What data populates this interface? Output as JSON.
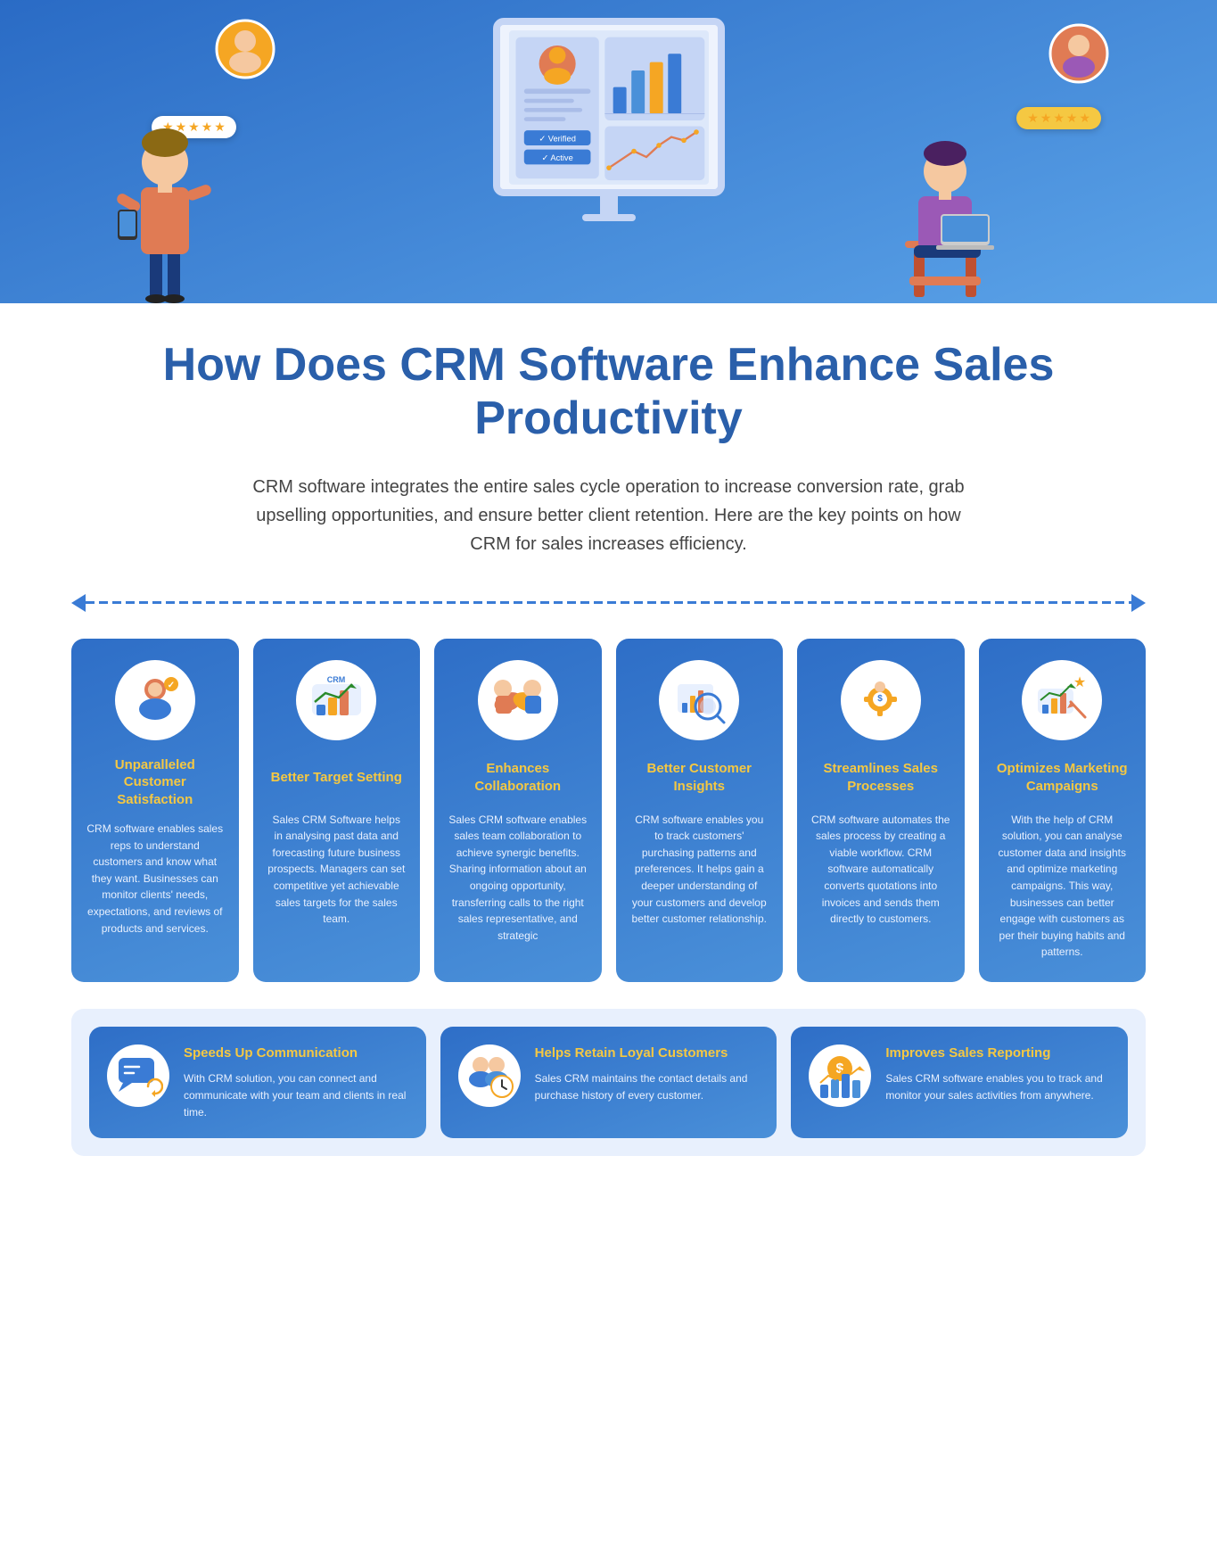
{
  "hero": {
    "stars_left": "★★★★★",
    "stars_right": "★★★★★"
  },
  "title": "How Does CRM Software Enhance Sales Productivity",
  "intro": "CRM software integrates the entire sales cycle operation to increase conversion rate, grab upselling opportunities, and ensure better client retention. Here are the key points on how CRM for sales increases efficiency.",
  "cards": [
    {
      "id": "unparalleled",
      "title": "Unparalleled Customer Satisfaction",
      "desc": "CRM software enables sales reps to understand customers and know what they want. Businesses can monitor clients' needs, expectations, and reviews of products and services.",
      "icon": "👤"
    },
    {
      "id": "target",
      "title": "Better Target Setting",
      "desc": "Sales CRM Software helps in analysing past data and forecasting future business prospects. Managers can set competitive yet achievable sales targets for the sales team.",
      "icon": "📊"
    },
    {
      "id": "collaboration",
      "title": "Enhances Collaboration",
      "desc": "Sales CRM software enables sales team collaboration to achieve synergic benefits. Sharing information about an ongoing opportunity, transferring calls to the right sales representative, and strategic",
      "icon": "🤝"
    },
    {
      "id": "insights",
      "title": "Better Customer Insights",
      "desc": "CRM software enables you to track customers' purchasing patterns and preferences. It helps gain a deeper understanding of your customers and develop better customer relationship.",
      "icon": "🔍"
    },
    {
      "id": "streamlines",
      "title": "Streamlines Sales Processes",
      "desc": "CRM software automates the sales process by creating a viable workflow. CRM software automatically converts quotations into invoices and sends them directly to customers.",
      "icon": "⚙️"
    },
    {
      "id": "marketing",
      "title": "Optimizes Marketing Campaigns",
      "desc": "With the help of CRM solution, you can analyse customer data and insights and optimize marketing campaigns. This way, businesses can better engage with customers as per their buying habits and patterns.",
      "icon": "📣"
    }
  ],
  "bottom_cards": [
    {
      "id": "communication",
      "title": "Speeds Up Communication",
      "desc": "With CRM solution, you can connect and communicate with your team and clients in real time.",
      "icon": "💬"
    },
    {
      "id": "loyal",
      "title": "Helps Retain Loyal Customers",
      "desc": "Sales CRM maintains the contact details and purchase history of every customer.",
      "icon": "👥"
    },
    {
      "id": "reporting",
      "title": "Improves Sales Reporting",
      "desc": "Sales CRM software enables you to track and monitor your sales activities from anywhere.",
      "icon": "💲"
    }
  ]
}
